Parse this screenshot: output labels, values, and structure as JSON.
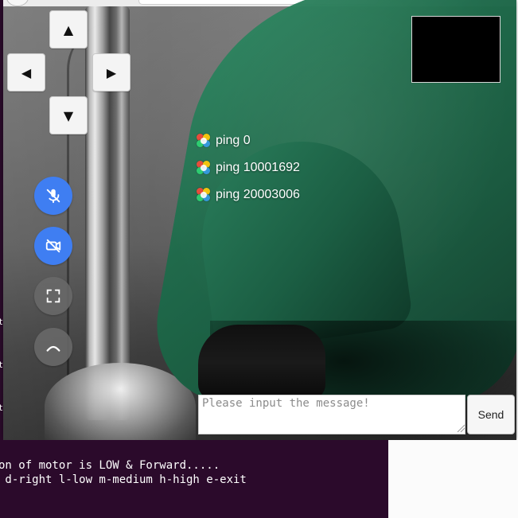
{
  "controls": {
    "up": "▲",
    "left": "◀",
    "right": "▶",
    "down": "▼"
  },
  "pings": [
    {
      "label": "ping 0"
    },
    {
      "label": "ping 10001692"
    },
    {
      "label": "ping 20003006"
    }
  ],
  "message": {
    "placeholder": "Please input the message!",
    "send_label": "Send"
  },
  "terminal": {
    "line1": "on of motor is LOW & Forward.....",
    "line2": " d-right l-low m-medium h-high e-exit"
  },
  "left_strip_chars": [
    "t",
    "t",
    "t"
  ],
  "colors": {
    "call_button_blue": "#3f7ef2",
    "terminal_bg": "#2b0a2b",
    "pip_bg": "#000000"
  }
}
